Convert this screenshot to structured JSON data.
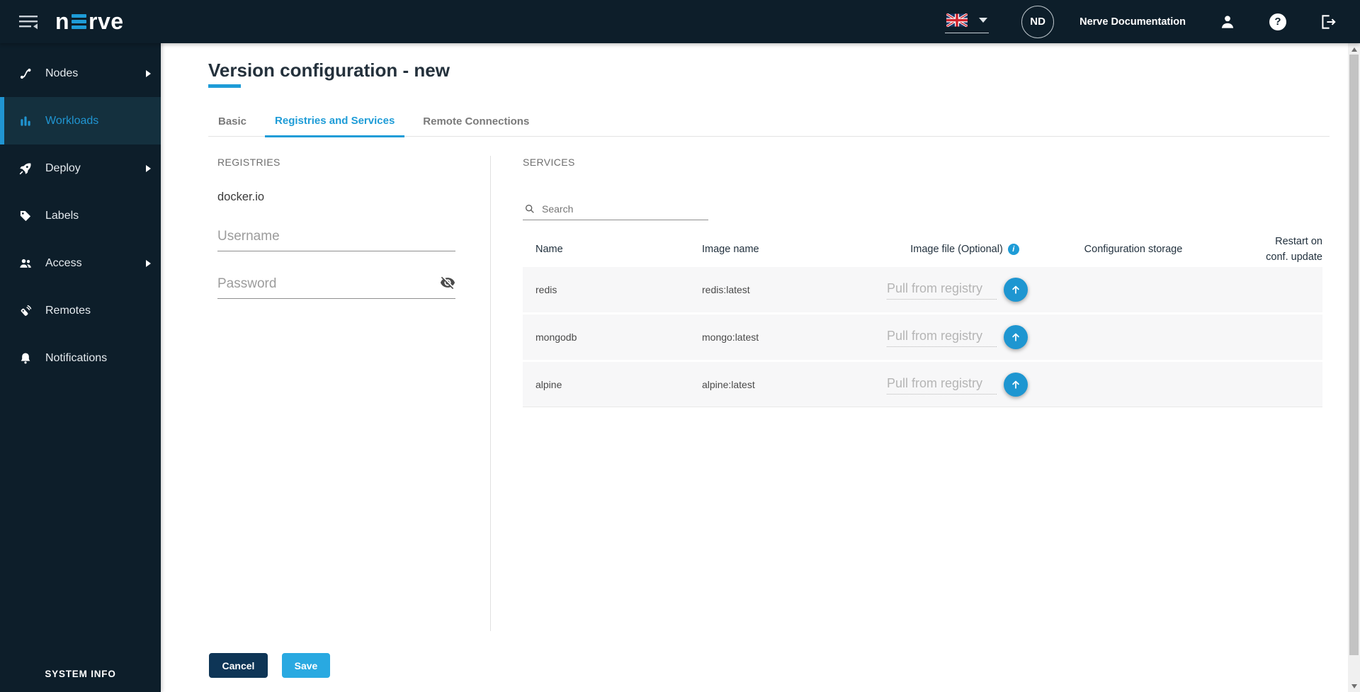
{
  "topbar": {
    "logo_prefix": "n",
    "logo_suffix": "rve",
    "avatar_initials": "ND",
    "doc_link_label": "Nerve Documentation"
  },
  "sidebar": {
    "items": [
      {
        "label": "Nodes"
      },
      {
        "label": "Workloads"
      },
      {
        "label": "Deploy"
      },
      {
        "label": "Labels"
      },
      {
        "label": "Access"
      },
      {
        "label": "Remotes"
      },
      {
        "label": "Notifications"
      }
    ],
    "footer_label": "SYSTEM INFO"
  },
  "page": {
    "title": "Version configuration - new",
    "tabs": [
      {
        "label": "Basic"
      },
      {
        "label": "Registries and Services"
      },
      {
        "label": "Remote Connections"
      }
    ]
  },
  "registries": {
    "heading": "REGISTRIES",
    "registry_name": "docker.io",
    "username_placeholder": "Username",
    "password_placeholder": "Password"
  },
  "services": {
    "heading": "SERVICES",
    "search_placeholder": "Search",
    "table": {
      "columns": [
        "Name",
        "Image name",
        "Image file (Optional)",
        "Configuration storage",
        "Restart on conf. update"
      ],
      "rows": [
        {
          "name": "redis",
          "image": "redis:latest",
          "image_file_placeholder": "Pull from registry"
        },
        {
          "name": "mongodb",
          "image": "mongo:latest",
          "image_file_placeholder": "Pull from registry"
        },
        {
          "name": "alpine",
          "image": "alpine:latest",
          "image_file_placeholder": "Pull from registry"
        }
      ]
    }
  },
  "footer_actions": {
    "cancel_label": "Cancel",
    "save_label": "Save"
  },
  "colors": {
    "accent_blue": "#1E9CD7",
    "topbar_bg": "#0D1E2A",
    "active_item_bg": "#14303E",
    "save_bg": "#29A9E1",
    "cancel_bg": "#0E3556",
    "row_bg": "#F7F7F8"
  }
}
